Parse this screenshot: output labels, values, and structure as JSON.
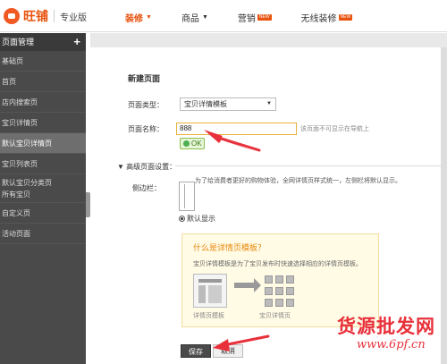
{
  "app": {
    "logo_text": "旺铺",
    "edition": "专业版"
  },
  "nav": {
    "items": [
      {
        "label": "装修",
        "caret": "▼",
        "active": true
      },
      {
        "label": "商品",
        "caret": "▼"
      },
      {
        "label": "营销",
        "badge": "NEW"
      },
      {
        "label": "无线装修",
        "badge": "NEW"
      }
    ]
  },
  "sidebar": {
    "title": "页面管理",
    "add_symbol": "+",
    "items": [
      {
        "label": "基础页"
      },
      {
        "label": "首页"
      },
      {
        "label": "店内搜索页"
      },
      {
        "label": "宝贝详情页"
      },
      {
        "label": "默认宝贝详情页",
        "active": true
      },
      {
        "label": "宝贝列表页"
      },
      {
        "label": "默认宝贝分类页",
        "line2": "所有宝贝"
      },
      {
        "label": "自定义页"
      },
      {
        "label": "活动页面"
      }
    ]
  },
  "form": {
    "heading": "新建页面",
    "page_type_label": "页面类型：",
    "page_type_value": "宝贝详情模板",
    "page_name_label": "页面名称：",
    "page_name_value": "888",
    "page_name_hint": "该页面不可显示在导航上",
    "ok_label": "OK",
    "advanced_label": "高级页面设置：",
    "sidebar_label": "侧边栏：",
    "sidebar_desc": "为了给消费者更好的购物体验，全网详情页样式统一，左侧栏将默认显示。",
    "radio_label": "默认显示"
  },
  "info": {
    "title": "什么是详情页模板？",
    "desc": "宝贝详情模板是为了宝贝发布时快速选择相应的详情页模板。",
    "cap_left": "详情页模板",
    "cap_right": "宝贝详情页"
  },
  "buttons": {
    "save": "保存",
    "cancel": "取消"
  },
  "watermark": {
    "line1": "货源批发网",
    "line2": "www.6pf.cn"
  },
  "colors": {
    "accent": "#e8520d",
    "sidebar_bg": "#4a4a4a",
    "annotation_red": "#e8303a"
  }
}
